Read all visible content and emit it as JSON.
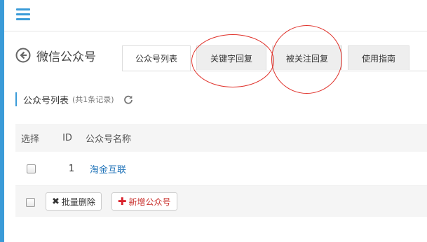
{
  "page": {
    "title": "微信公众号"
  },
  "tabs": [
    {
      "label": "公众号列表",
      "active": true
    },
    {
      "label": "关键字回复",
      "active": false
    },
    {
      "label": "被关注回复",
      "active": false
    },
    {
      "label": "使用指南",
      "active": false
    }
  ],
  "section": {
    "title": "公众号列表",
    "count": "(共1条记录)"
  },
  "table": {
    "headers": {
      "select": "选择",
      "id": "ID",
      "name": "公众号名称"
    },
    "rows": [
      {
        "id": "1",
        "name": "淘金互联"
      }
    ]
  },
  "actions": {
    "batch_delete": "批量删除",
    "add_account": "新增公众号"
  },
  "icons": {
    "menu": "hamburger-menu-icon",
    "back": "back-arrow-icon",
    "refresh": "refresh-icon",
    "delete": "x-icon",
    "add": "plus-icon"
  },
  "colors": {
    "accent": "#3a9bd8",
    "link": "#1e72b8",
    "danger": "#d9232d",
    "annotation": "#e0312a"
  }
}
